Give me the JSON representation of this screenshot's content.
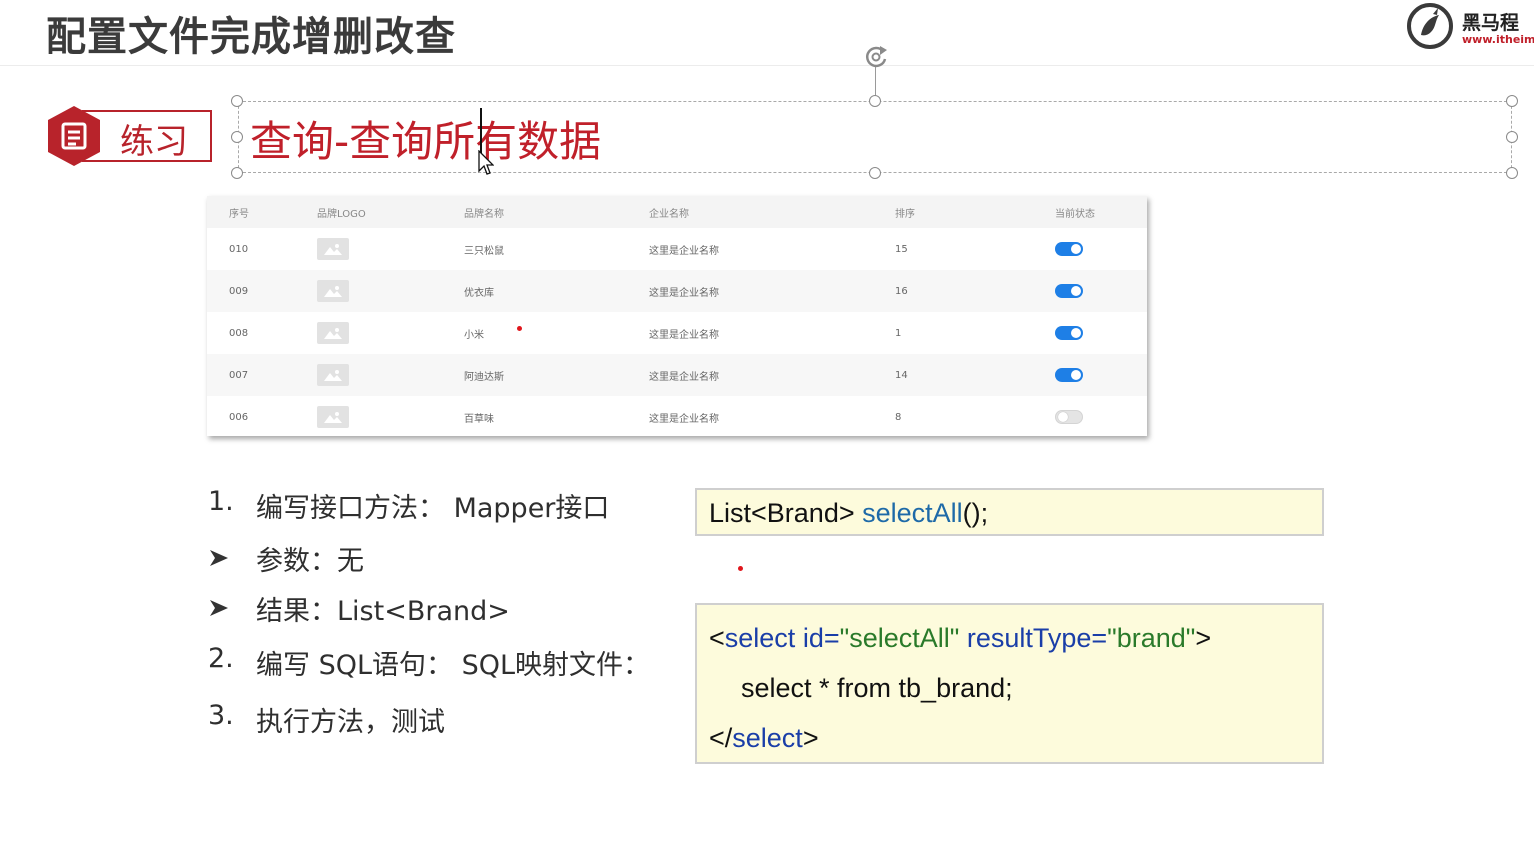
{
  "slide": {
    "title": "配置文件完成增删改查"
  },
  "logo": {
    "name": "黑马程",
    "url": "www.itheim"
  },
  "practice": {
    "label": "练习"
  },
  "section": {
    "title": "查询-查询所有数据"
  },
  "brand_table": {
    "headers": [
      "序号",
      "品牌LOGO",
      "品牌名称",
      "企业名称",
      "排序",
      "当前状态"
    ],
    "rows": [
      {
        "seq": "010",
        "name": "三只松鼠",
        "company": "这里是企业名称",
        "order": "15",
        "status": "on"
      },
      {
        "seq": "009",
        "name": "优衣库",
        "company": "这里是企业名称",
        "order": "16",
        "status": "on"
      },
      {
        "seq": "008",
        "name": "小米",
        "company": "这里是企业名称",
        "order": "1",
        "status": "on"
      },
      {
        "seq": "007",
        "name": "阿迪达斯",
        "company": "这里是企业名称",
        "order": "14",
        "status": "on"
      },
      {
        "seq": "006",
        "name": "百草味",
        "company": "这里是企业名称",
        "order": "8",
        "status": "off"
      }
    ]
  },
  "steps": {
    "s1_num": "1.",
    "s1_text": "编写接口方法：  Mapper接口",
    "b1_text": "参数：无",
    "b2_text": "结果：List<Brand>",
    "s2_num": "2.",
    "s2_text": "编写 SQL语句：  SQL映射文件：",
    "s3_num": "3.",
    "s3_text": "执行方法，测试"
  },
  "code_interface": {
    "return_type": "List<Brand> ",
    "method": "selectAll",
    "suffix": "();"
  },
  "code_xml": {
    "l1_open": "<",
    "l1_tag": "select",
    "l1_attr1": " id=",
    "l1_val1": "\"selectAll\"",
    "l1_attr2": " resultType=",
    "l1_val2": "\"brand\"",
    "l1_close": ">",
    "l2": "select * from tb_brand;",
    "l3_open": "</",
    "l3_tag": "select",
    "l3_close": ">"
  },
  "colors": {
    "accent_red": "#c0202a",
    "toggle_on": "#1e7fe6",
    "code_bg": "#fdfbdc",
    "keyword_blue": "#1a3ea8",
    "string_green": "#2a7a2a"
  }
}
